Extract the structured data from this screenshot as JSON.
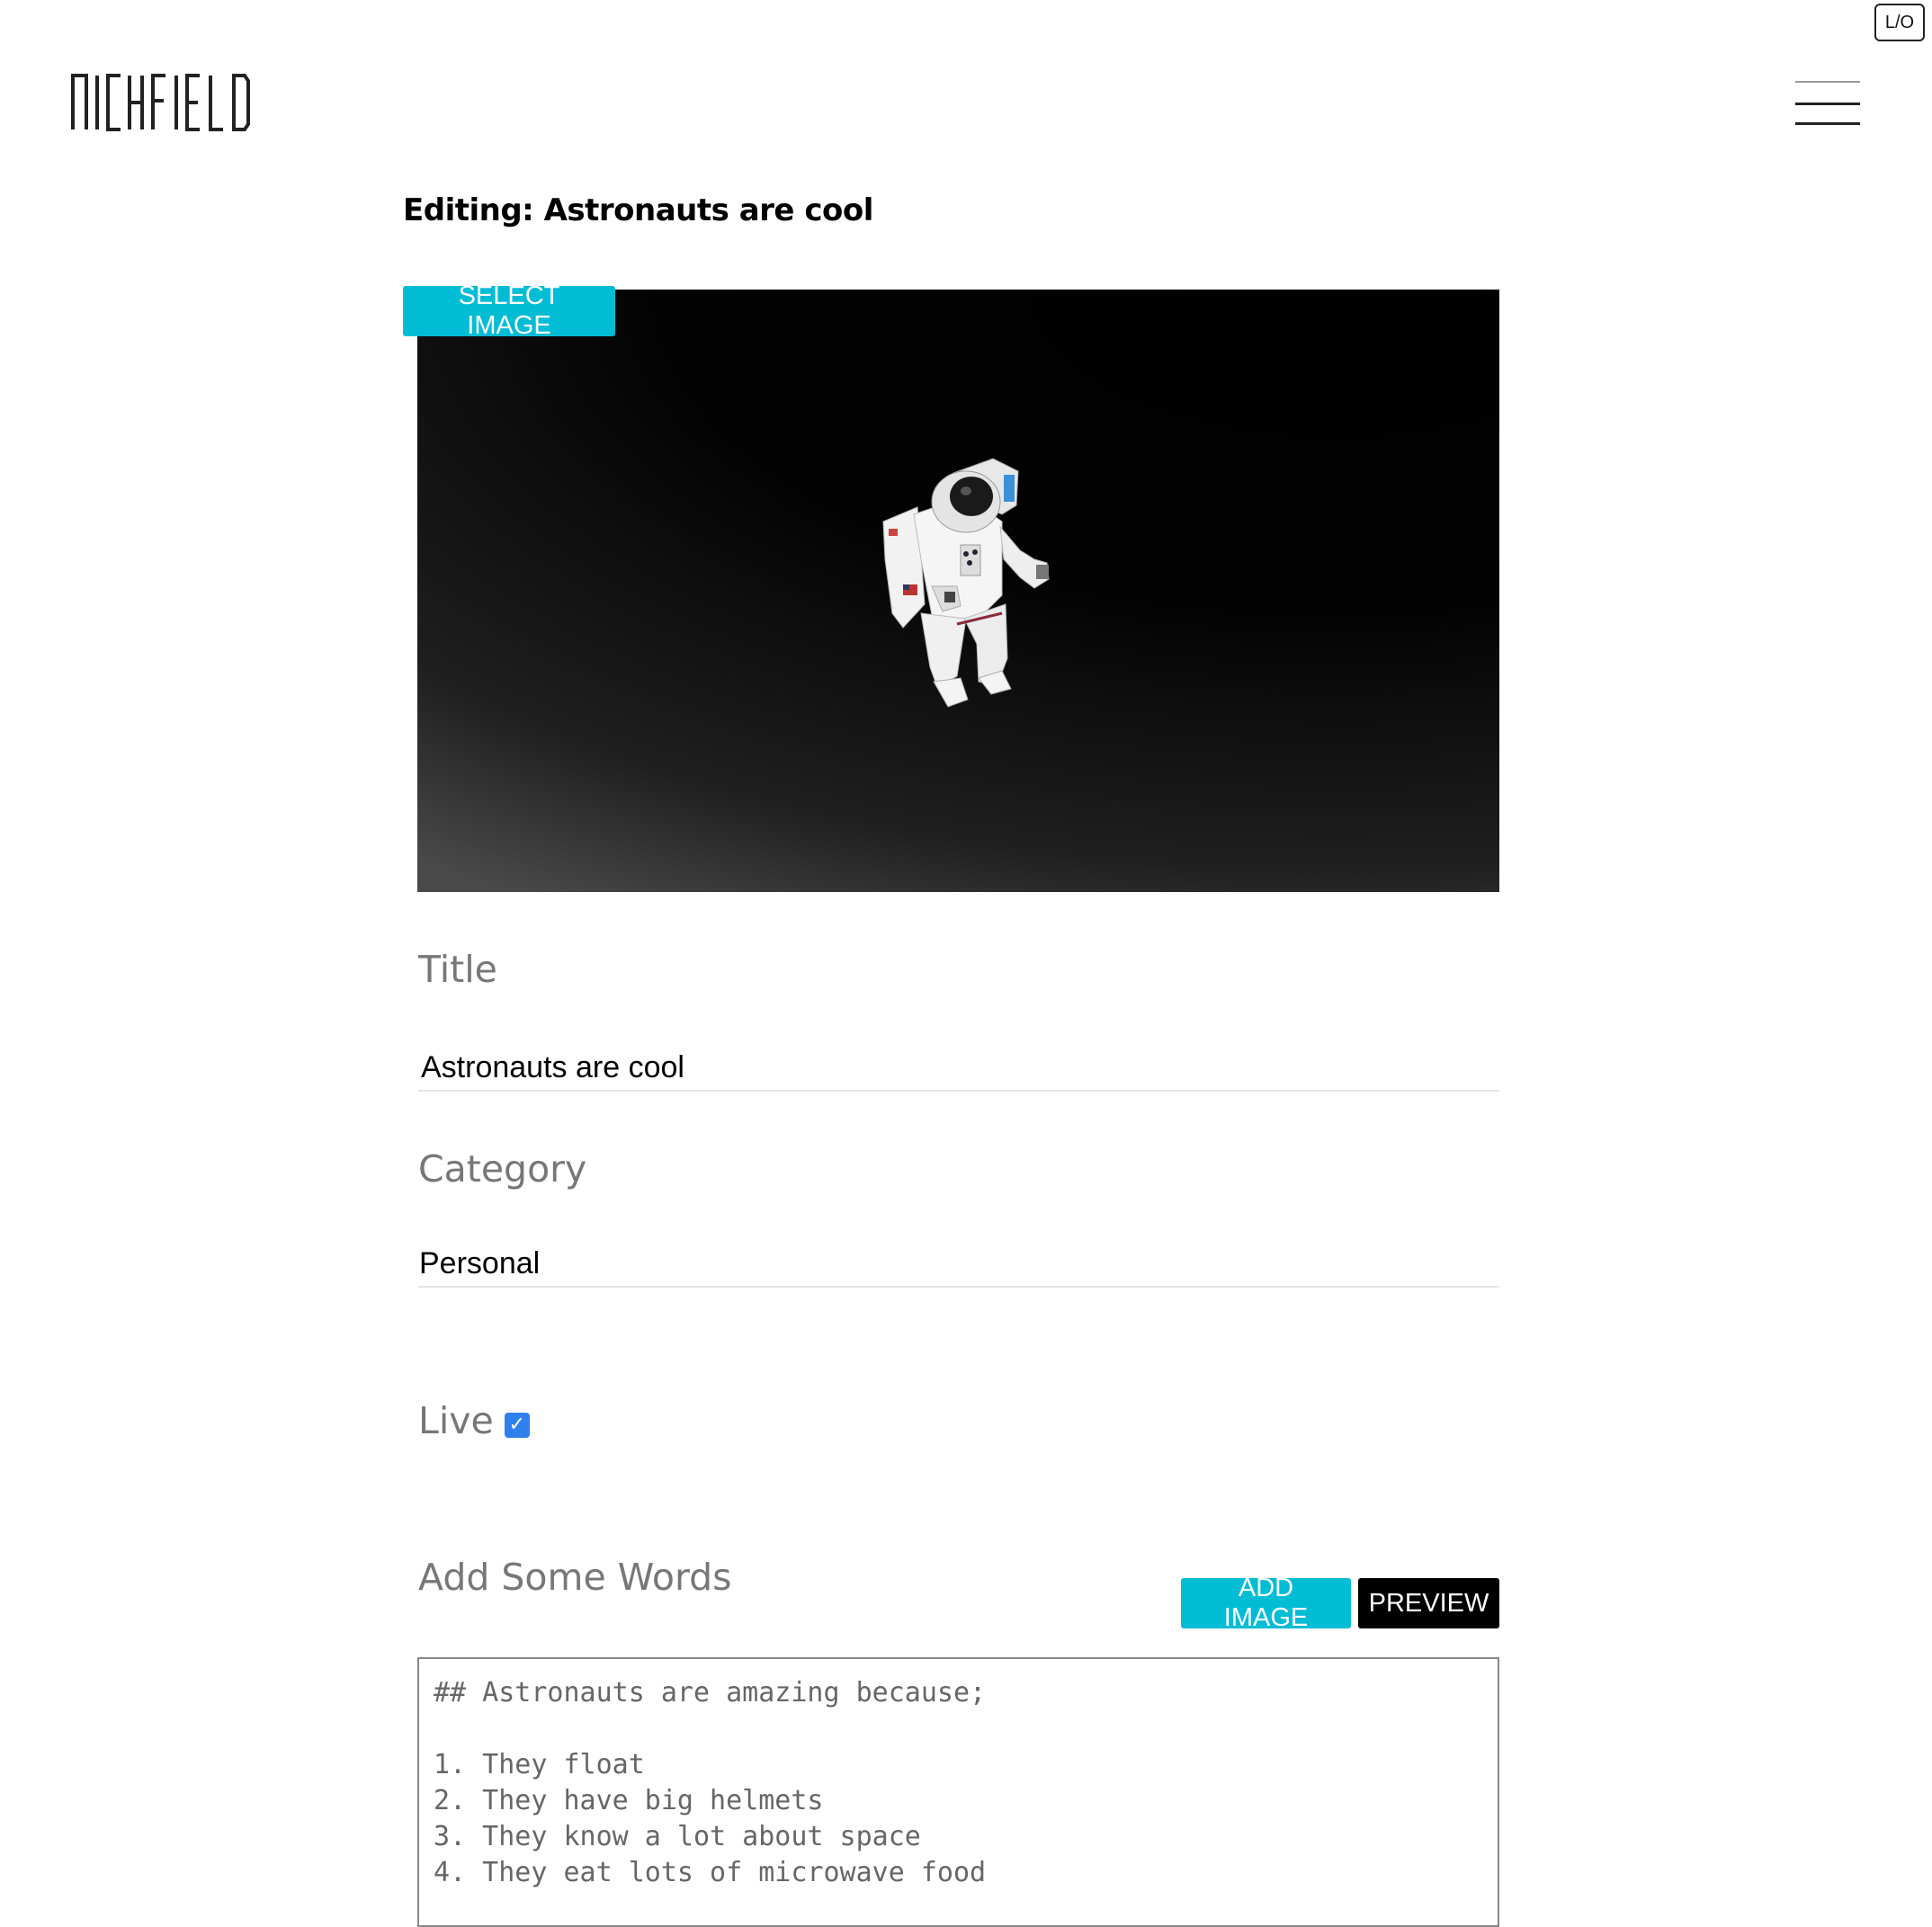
{
  "header": {
    "logout_label": "L/O",
    "logo_text": "NICKFIELD"
  },
  "page": {
    "heading": "Editing: Astronauts are cool"
  },
  "hero": {
    "select_image_label": "SELECT IMAGE"
  },
  "form": {
    "title_label": "Title",
    "title_value": "Astronauts are cool",
    "category_label": "Category",
    "category_value": "Personal",
    "live_label": "Live",
    "live_checked": true,
    "words_label": "Add Some Words",
    "add_image_label": "ADD IMAGE",
    "preview_label": "PREVIEW",
    "body_value": "## Astronauts are amazing because;\n\n1. They float\n2. They have big helmets\n3. They know a lot about space\n4. They eat lots of microwave food"
  },
  "colors": {
    "accent": "#00bcd4",
    "checkbox": "#2f80ed"
  },
  "icons": {
    "menu": "hamburger-menu-icon",
    "checkbox": "check-icon"
  }
}
